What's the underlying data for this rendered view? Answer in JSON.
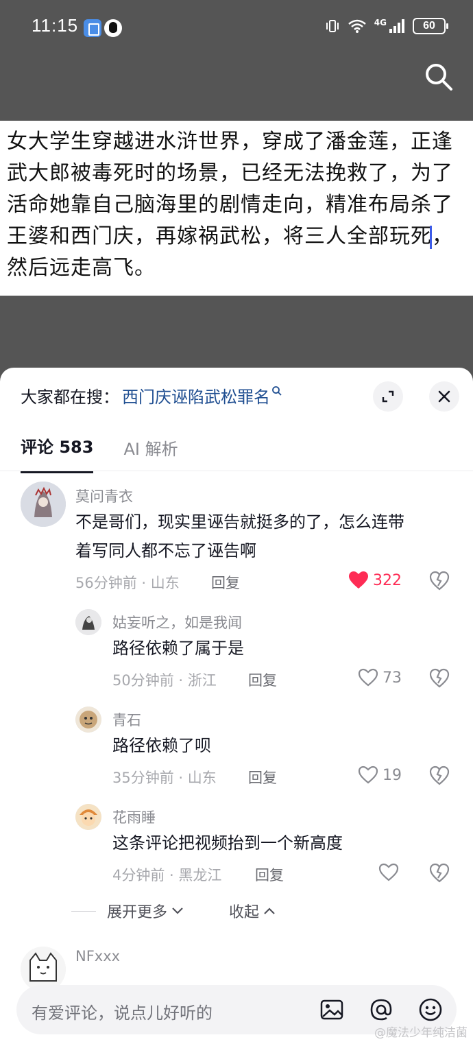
{
  "status_bar": {
    "time": "11:15",
    "network": "4G",
    "battery": "60",
    "icons": [
      "notification-app-icon",
      "qq-penguin-icon",
      "vibrate-icon",
      "wifi-icon",
      "signal-icon",
      "battery-icon"
    ]
  },
  "video": {
    "search_icon": "search-icon",
    "caption_lines": [
      "女大学生穿越进水浒世界，穿成了潘金莲，正逢",
      "武大郎被毒死时的场景，已经无法挽救了，为了",
      "活命她靠自己脑海里的剧情走向，精准布局杀了",
      "王婆和西门庆，再嫁祸武松，将三人全部玩死",
      "然后远走高飞。"
    ],
    "caption_line4_tail": "，"
  },
  "sheet": {
    "hot_search_label": "大家都在搜：",
    "hot_search_term": "西门庆诬陷武松罪名",
    "tabs": [
      {
        "label": "评论 583",
        "active": true
      },
      {
        "label": "AI 解析",
        "active": false
      }
    ],
    "comments": [
      {
        "user": "莫问青衣",
        "text_lines": [
          "不是哥们，现实里诬告就挺多的了，怎么连带",
          "着写同人都不忘了诬告啊"
        ],
        "meta": "56分钟前 · 山东",
        "reply": "回复",
        "likes": "322",
        "liked": true
      },
      {
        "user": "姑妄听之，如是我闻",
        "text_lines": [
          "路径依赖了属于是"
        ],
        "meta": "50分钟前 · 浙江",
        "reply": "回复",
        "likes": "73",
        "liked": false
      },
      {
        "user": "青石",
        "text_lines": [
          "路径依赖了呗"
        ],
        "meta": "35分钟前 · 山东",
        "reply": "回复",
        "likes": "19",
        "liked": false
      },
      {
        "user": "花雨睡",
        "text_lines": [
          "这条评论把视频抬到一个新高度"
        ],
        "meta": "4分钟前 · 黑龙江",
        "reply": "回复",
        "likes": "",
        "liked": false
      },
      {
        "user": "NFxxx",
        "text_lines": [],
        "meta": "",
        "reply": "",
        "likes": "",
        "liked": false
      }
    ],
    "expand_more": "展开更多",
    "collapse": "收起",
    "input_placeholder": "有爱评论，说点儿好听的",
    "watermark": "@魔法少年纯洁菌"
  },
  "colors": {
    "accent_like": "#fe2c55",
    "hot_term": "#1f4e91",
    "text": "#161823",
    "secondary": "#8a8b91"
  }
}
